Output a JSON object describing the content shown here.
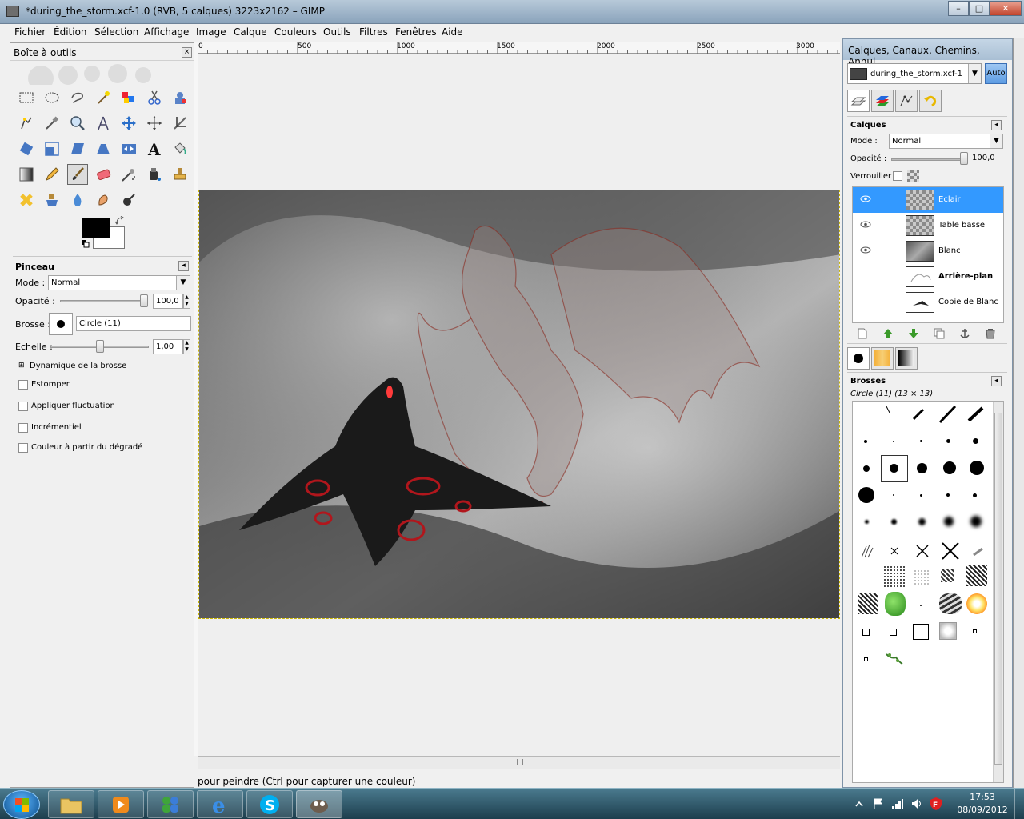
{
  "window": {
    "title": "*during_the_storm.xcf-1.0 (RVB, 5 calques) 3223x2162 – GIMP",
    "min": "–",
    "max": "□",
    "close": "✕"
  },
  "menu": [
    "Fichier",
    "Édition",
    "Sélection",
    "Affichage",
    "Image",
    "Calque",
    "Couleurs",
    "Outils",
    "Filtres",
    "Fenêtres",
    "Aide"
  ],
  "toolbox": {
    "title": "Boîte à outils",
    "tool_options_title": "Pinceau",
    "mode_label": "Mode :",
    "mode_value": "Normal",
    "opacity_label": "Opacité :",
    "opacity_value": "100,0",
    "brush_label": "Brosse :",
    "brush_value": "Circle (11)",
    "scale_label": "Échelle :",
    "scale_value": "1,00",
    "dynamics_label": "Dynamique de la brosse",
    "fade_label": "Estomper",
    "jitter_label": "Appliquer fluctuation",
    "incremental_label": "Incrémentiel",
    "gradient_label": "Couleur à partir du dégradé",
    "opacity_fraction": 1.0,
    "scale_fraction": 0.5
  },
  "ruler": {
    "ticks": [
      "0",
      "500",
      "1000",
      "1500",
      "2000",
      "2500",
      "3000"
    ]
  },
  "status_text": "pour peindre (Ctrl pour capturer une couleur)",
  "dock": {
    "title": "Calques, Canaux, Chemins, Annul...",
    "image_selector": "during_the_storm.xcf-1",
    "auto_label": "Auto",
    "layers_title": "Calques",
    "mode_label": "Mode :",
    "mode_value": "Normal",
    "opacity_label": "Opacité :",
    "opacity_value": "100,0",
    "lock_label": "Verrouiller :",
    "layers": [
      {
        "name": "Eclair",
        "visible": true,
        "selected": true
      },
      {
        "name": "Table basse",
        "visible": true,
        "selected": false
      },
      {
        "name": "Blanc",
        "visible": true,
        "selected": false
      },
      {
        "name": "Arrière-plan",
        "visible": false,
        "selected": false
      },
      {
        "name": "Copie de Blanc",
        "visible": false,
        "selected": false
      }
    ],
    "brushes_title": "Brosses",
    "brush_current": "Circle (11) (13 × 13)"
  },
  "taskbar": {
    "time": "17:53",
    "date": "08/09/2012"
  },
  "colors": {
    "selection": "#3399ff",
    "fg": "#000000",
    "bg": "#ffffff"
  }
}
